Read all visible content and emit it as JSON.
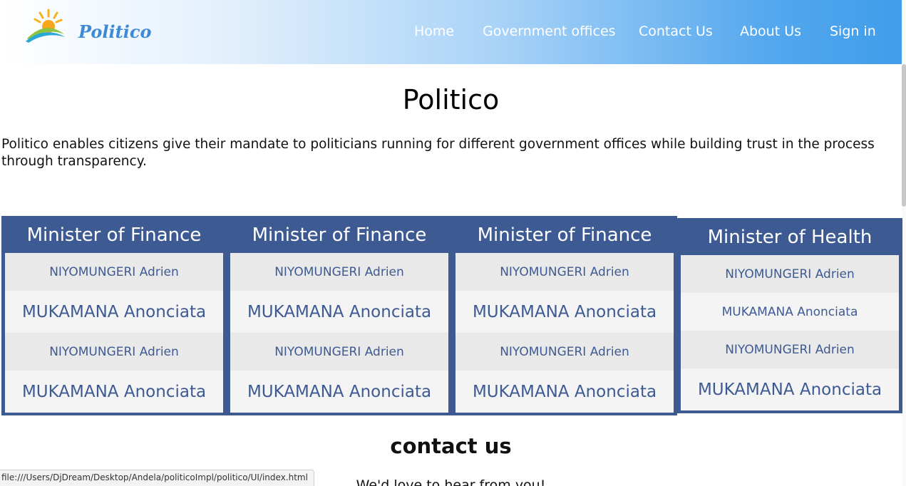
{
  "brand": {
    "name": "Politico"
  },
  "nav": {
    "items": [
      {
        "label": "Home"
      },
      {
        "label": "Government offices"
      },
      {
        "label": "Contact Us"
      },
      {
        "label": "About Us"
      },
      {
        "label": "Sign in"
      }
    ]
  },
  "main": {
    "title": "Politico",
    "intro": "Politico enables citizens give their mandate to politicians running for different government offices while building trust in the process through transparency."
  },
  "offices": [
    {
      "title": "Minister of Finance",
      "candidates": [
        "NIYOMUNGERI Adrien",
        "MUKAMANA Anonciata",
        "NIYOMUNGERI Adrien",
        "MUKAMANA Anonciata"
      ]
    },
    {
      "title": "Minister of Finance",
      "candidates": [
        "NIYOMUNGERI Adrien",
        "MUKAMANA Anonciata",
        "NIYOMUNGERI Adrien",
        "MUKAMANA Anonciata"
      ]
    },
    {
      "title": "Minister of Finance",
      "candidates": [
        "NIYOMUNGERI Adrien",
        "MUKAMANA Anonciata",
        "NIYOMUNGERI Adrien",
        "MUKAMANA Anonciata"
      ]
    },
    {
      "title": "Minister of Health",
      "candidates": [
        "NIYOMUNGERI Adrien",
        "MUKAMANA Anonciata",
        "NIYOMUNGERI Adrien",
        "MUKAMANA Anonciata"
      ]
    }
  ],
  "contact": {
    "title": "contact us",
    "subtitle": "We'd love to hear from you!"
  },
  "status_bar": {
    "url": "file:///Users/DjDream/Desktop/Andela/politicoImpl/politico/UI/index.html"
  },
  "colors": {
    "nav_gradient_end": "#3f9de9",
    "brand": "#3d8ad6",
    "office_header": "#3e5a93",
    "candidate_text": "#3e5a93"
  }
}
